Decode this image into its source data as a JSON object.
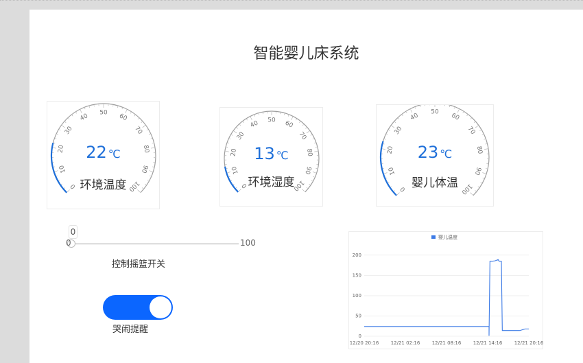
{
  "page": {
    "title": "智能婴儿床系统"
  },
  "gauges": [
    {
      "id": "env-temp",
      "label": "环境温度",
      "value": 22,
      "unit": "℃",
      "min": 0,
      "max": 100,
      "ticks": [
        "0",
        "10",
        "20",
        "30",
        "40",
        "50",
        "60",
        "70",
        "80",
        "90",
        "100"
      ]
    },
    {
      "id": "env-humidity",
      "label": "环境湿度",
      "value": 13,
      "unit": "℃",
      "min": 0,
      "max": 100,
      "ticks": [
        "0",
        "10",
        "20",
        "30",
        "40",
        "50",
        "60",
        "70",
        "80",
        "90",
        "100"
      ]
    },
    {
      "id": "baby-temp",
      "label": "婴儿体温",
      "value": 23,
      "unit": "℃",
      "min": 0,
      "max": 100,
      "ticks": [
        "0",
        "10",
        "20",
        "30",
        "40",
        "50",
        "60",
        "70",
        "80",
        "90",
        "100"
      ]
    }
  ],
  "rocking_slider": {
    "value": "0",
    "min_label": "0",
    "max_label": "100",
    "caption": "控制摇篮开关"
  },
  "cry_alert_toggle": {
    "caption": "哭闹提醒",
    "on": true
  },
  "chart_data": {
    "type": "line",
    "title": "",
    "legend": [
      "婴儿温度"
    ],
    "legend_position": "top-center",
    "xlabel": "",
    "ylabel": "",
    "ylim": [
      0,
      215
    ],
    "y_ticks": [
      "0",
      "50",
      "100",
      "150",
      "200"
    ],
    "x_tick_labels": [
      "12/20 20:16",
      "12/21 02:16",
      "12/21 08:16",
      "12/21 14:16",
      "12/21 20:16"
    ],
    "series": [
      {
        "name": "婴儿温度",
        "color": "#3d7be6",
        "x": [
          0,
          27.3,
          27.3,
          27.5,
          28.0,
          28.6,
          29.3,
          29.5,
          30.0,
          30.2,
          31.5,
          32.2,
          34.0,
          35.2,
          36.0
        ],
        "y": [
          24,
          24,
          1,
          185,
          185,
          186,
          189,
          185,
          185,
          14,
          14,
          14,
          14,
          18,
          18
        ]
      }
    ],
    "grid": true
  },
  "colors": {
    "accent": "#0b66ff",
    "gauge_blue": "#1e6fd9",
    "gauge_gray": "#9e9e9e"
  }
}
